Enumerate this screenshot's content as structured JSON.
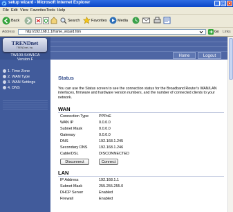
{
  "window": {
    "title": "setup wizard - Microsoft Internet Explorer"
  },
  "menu": [
    "File",
    "Edit",
    "View",
    "Favorites",
    "Tools",
    "Help"
  ],
  "toolbar": {
    "back": "Back",
    "search": "Search",
    "favorites": "Favorites",
    "media": "Media"
  },
  "address": {
    "label": "Address",
    "url": "http://192.168.1.1/frame_wizard.htm",
    "go": "Go",
    "links": "Links"
  },
  "brand": {
    "logo": "TRENDnet",
    "tagline": "TRENDnet, Inc.",
    "model_line1": "TW100-S4W1CA",
    "model_line2": "Version F"
  },
  "nav": [
    "1. Time Zone",
    "2. WAN Type",
    "3. WAN Settings",
    "4. DNS"
  ],
  "header": {
    "home": "Home",
    "logout": "Logout"
  },
  "page": {
    "title": "Status",
    "description": "You can use the Status screen to see the connection status for the Broadband Router's WAN/LAN interfaces, firmware and hardware version numbers, and the number of connected clients to your network."
  },
  "wan": {
    "heading": "WAN",
    "rows": [
      [
        "Connection Type",
        "PPPoE"
      ],
      [
        "WAN IP",
        "0.0.0.0"
      ],
      [
        "Subnet Mask",
        "0.0.0.0"
      ],
      [
        "Gateway",
        "0.0.0.0"
      ],
      [
        "DNS",
        "192.168.1.245"
      ],
      [
        "Secondary DNS",
        "192.168.1.246"
      ],
      [
        "Cable/DSL",
        "DISCONNECTED"
      ]
    ],
    "disconnect": "Disconnect",
    "connect": "Connect"
  },
  "lan": {
    "heading": "LAN",
    "rows": [
      [
        "IP Address",
        "192.168.1.1"
      ],
      [
        "Subnet Mask",
        "255.255.255.0"
      ],
      [
        "DHCP Server",
        "Enabled"
      ],
      [
        "Firewall",
        "Enabled"
      ]
    ]
  },
  "colors": {
    "sidebar": "#415b9b",
    "header": "#4e66a4",
    "title": "#3a5390"
  }
}
